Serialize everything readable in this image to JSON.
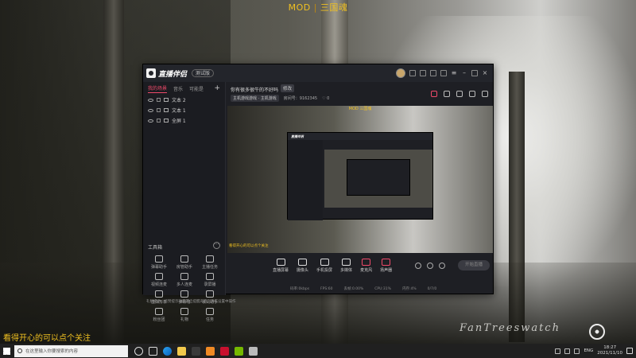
{
  "desktop": {
    "banner_left": "MOD",
    "banner_right": "三国魂",
    "subtitle": "看得开心的可以点个关注",
    "signature": "FanTreeswatch"
  },
  "app": {
    "name": "直播伴侣",
    "version": "测试版",
    "sidebar": {
      "tabs": [
        "我的场景",
        "音乐",
        "可能是"
      ],
      "add": "+",
      "layers": [
        "文本 2",
        "文本 1",
        "全屏 1"
      ],
      "tools_title": "工具箱",
      "tools": [
        "弹幕助手",
        "房管助手",
        "主播任务",
        "视频连麦",
        "多人连麦",
        "录屏播",
        "虚拟形象",
        "弹幕墙",
        "歌词助手",
        "粉丝团",
        "礼物",
        "任务"
      ],
      "notice": "礼物提示，点赞提示功能开启提醒声音，请在设置中操作"
    },
    "main": {
      "room_title": "你有很多很牛的不好吗",
      "edit_label": "修改",
      "category_tag": "主机游戏游戏 · 主机游戏",
      "room_id_label": "房间号：",
      "room_id": "9162345",
      "likes": "0",
      "preview_caption": "看得开心的可以点个关注",
      "preview_top": "MOD 三国魂",
      "controls": [
        "直播屏幕",
        "摄像头",
        "手机投屏",
        "多媒体",
        "麦克风",
        "扬声器"
      ],
      "live_button": "开始直播",
      "status": [
        "码率:0kbps",
        "FPS:60",
        "丢帧:0.00%",
        "CPU:31%",
        "内存:4%",
        "0/7/0"
      ]
    }
  },
  "taskbar": {
    "search_placeholder": "在这里输入你要搜索的内容",
    "tray_lang": "ENG",
    "time": "18:27",
    "date": "2021/11/10"
  },
  "colors": {
    "accent": "#f04a6a",
    "banner": "#f0c020"
  }
}
